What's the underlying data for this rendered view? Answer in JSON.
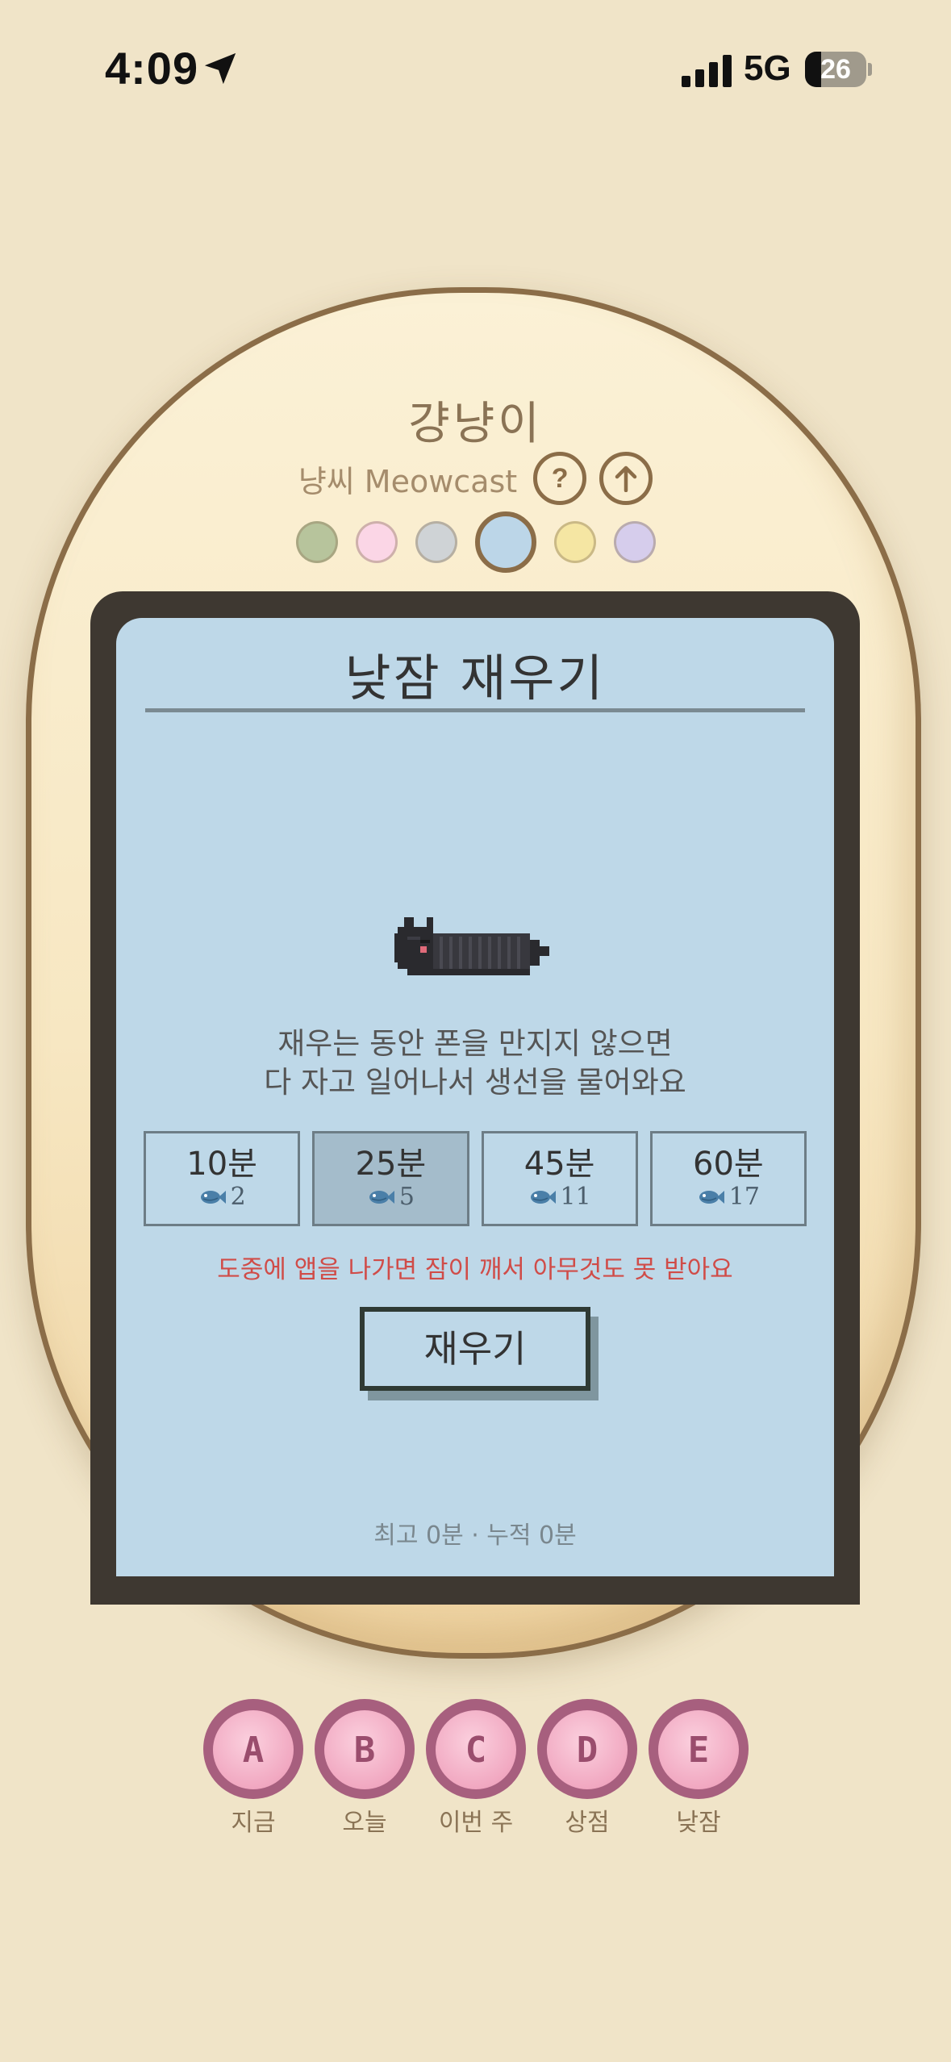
{
  "status_bar": {
    "time": "4:09",
    "network": "5G",
    "battery": "26"
  },
  "pet_name": "걍냥이",
  "subtitle": "냥씨 Meowcast",
  "help_button": "?",
  "share_icon": "arrow-up-circle-icon",
  "color_swatches": [
    "#b7c49c",
    "#fbd6e6",
    "#cfd3d6",
    "#bcd6e8",
    "#f5e6a3",
    "#d6cdec"
  ],
  "selected_swatch": 3,
  "screen": {
    "title": "낮잠 재우기",
    "description": [
      "재우는 동안 폰을 만지지 않으면",
      "다 자고 일어나서 생선을 물어와요"
    ],
    "options": [
      {
        "label": "10분",
        "reward": "2"
      },
      {
        "label": "25분",
        "reward": "5"
      },
      {
        "label": "45분",
        "reward": "11"
      },
      {
        "label": "60분",
        "reward": "17"
      }
    ],
    "selected_option": 1,
    "warning": "도중에 앱을 나가면 잠이 깨서 아무것도 못 받아요",
    "start_button": "재우기",
    "stats": "최고 0분 · 누적 0분"
  },
  "bottom_buttons": [
    {
      "glyph": "A",
      "label": "지금"
    },
    {
      "glyph": "B",
      "label": "오늘"
    },
    {
      "glyph": "C",
      "label": "이번 주"
    },
    {
      "glyph": "D",
      "label": "상점"
    },
    {
      "glyph": "E",
      "label": "낮잠"
    }
  ]
}
